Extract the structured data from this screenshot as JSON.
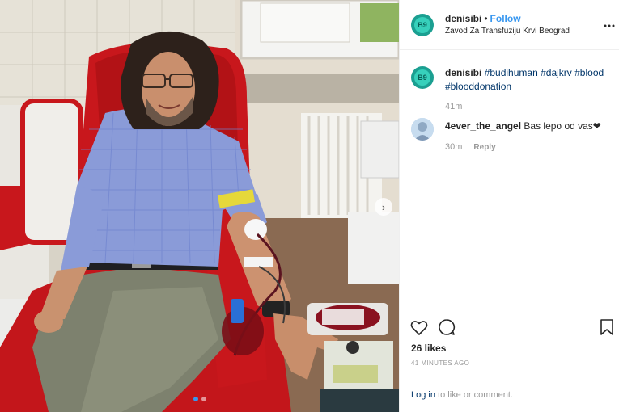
{
  "header": {
    "username": "denisibi",
    "separator": "•",
    "follow_label": "Follow",
    "location": "Zavod Za Transfuziju Krvi Beograd",
    "more_label": "•••",
    "avatar_initials": "B9"
  },
  "caption": {
    "username": "denisibi",
    "hashtags": [
      "#budihuman",
      "#dajkrv",
      "#blood",
      "#blooddonation"
    ],
    "time": "41m"
  },
  "comments": [
    {
      "username": "4ever_the_angel",
      "text": "Bas lepo od vas❤",
      "time": "30m",
      "reply_label": "Reply"
    }
  ],
  "actions": {
    "likes": "26 likes",
    "posted_ago": "41 MINUTES AGO"
  },
  "footer": {
    "login_link": "Log in",
    "login_rest": " to like or comment."
  },
  "carousel": {
    "slide_count": 2,
    "active_index": 0,
    "next_label": "›"
  },
  "colors": {
    "accent": "#3897f0",
    "hashtag": "#003569",
    "muted": "#999999",
    "chair_red": "#c8171c",
    "shirt_blue": "#8a9bd8"
  }
}
